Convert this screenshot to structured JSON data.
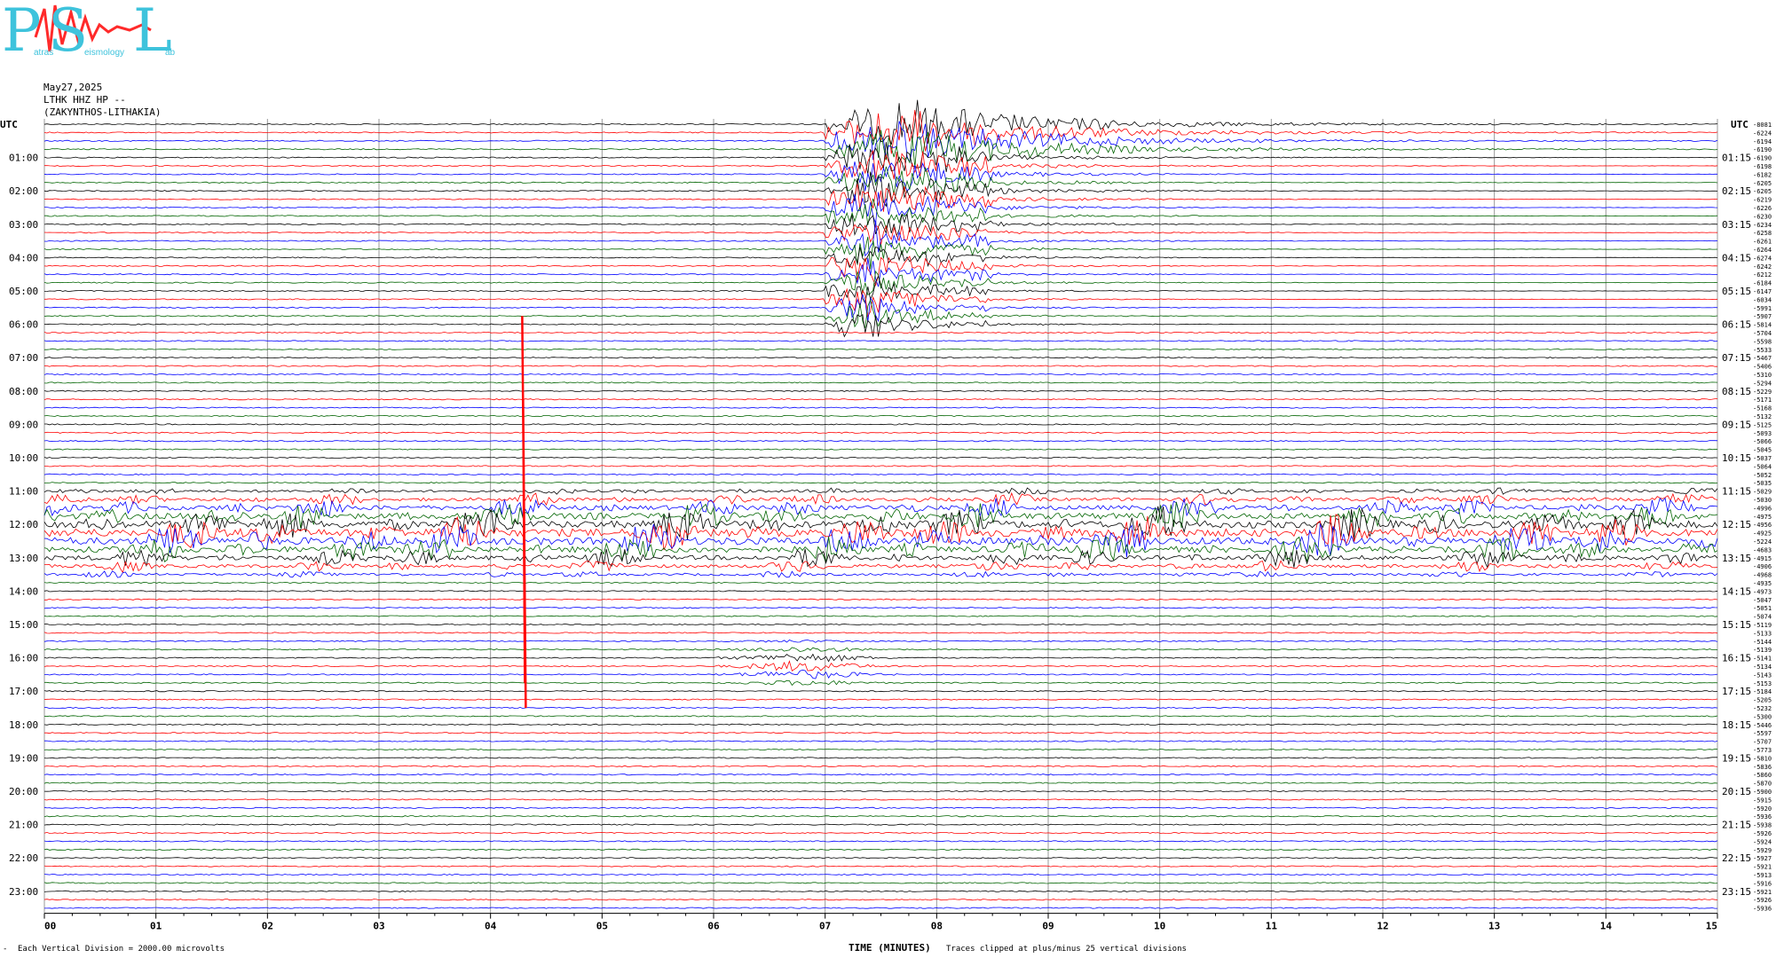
{
  "logo": {
    "letters": [
      "P",
      "S",
      "L"
    ],
    "small_texts": [
      "atras",
      "eismology",
      "ab"
    ],
    "color": "#3ec3dc"
  },
  "header": {
    "date": "May27,2025",
    "station": "LTHK HHZ HP --",
    "location": "(ZAKYNTHOS-LITHAKIA)"
  },
  "left_axis_title": "UTC",
  "right_axis_title": "UTC",
  "footer": {
    "marker": "-",
    "vertical_division": "Each Vertical Division = 2000.00 microvolts",
    "x_axis_title": "TIME (MINUTES)",
    "clip_note": "Traces clipped at plus/minus 25 vertical divisions"
  },
  "chart_data": {
    "type": "line",
    "title": "",
    "xlabel": "TIME (MINUTES)",
    "xlim": [
      0,
      15
    ],
    "x_ticks": [
      "00",
      "01",
      "02",
      "03",
      "04",
      "05",
      "06",
      "07",
      "08",
      "09",
      "10",
      "11",
      "12",
      "13",
      "14",
      "15"
    ],
    "left_hour_labels": [
      "01:00",
      "02:00",
      "03:00",
      "04:00",
      "05:00",
      "06:00",
      "07:00",
      "08:00",
      "09:00",
      "10:00",
      "11:00",
      "12:00",
      "13:00",
      "14:00",
      "15:00",
      "16:00",
      "17:00",
      "18:00",
      "19:00",
      "20:00",
      "21:00",
      "22:00",
      "23:00"
    ],
    "right_hour_labels": [
      "01:15",
      "02:15",
      "03:15",
      "04:15",
      "05:15",
      "06:15",
      "07:15",
      "08:15",
      "09:15",
      "10:15",
      "11:15",
      "12:15",
      "13:15",
      "14:15",
      "15:15",
      "16:15",
      "17:15",
      "18:15",
      "19:15",
      "20:15",
      "21:15",
      "22:15",
      "23:15"
    ],
    "trace_colors": [
      "#000000",
      "#ff0000",
      "#0000ff",
      "#006400"
    ],
    "traces_per_hour": 4,
    "trace_minutes": 15,
    "trace_offsets": [
      "-8081",
      "-6224",
      "-6194",
      "-6190",
      "-6190",
      "-6198",
      "-6182",
      "-6205",
      "-6205",
      "-6219",
      "-6226",
      "-6230",
      "-6234",
      "-6258",
      "-6261",
      "-6264",
      "-6274",
      "-6242",
      "-6212",
      "-6184",
      "-6147",
      "-6034",
      "-5991",
      "-5907",
      "-5814",
      "-5704",
      "-5598",
      "-5533",
      "-5467",
      "-5406",
      "-5310",
      "-5294",
      "-5229",
      "-5171",
      "-5168",
      "-5132",
      "-5125",
      "-5093",
      "-5066",
      "-5045",
      "-5037",
      "-5064",
      "-5052",
      "-5035",
      "-5029",
      "-5030",
      "-4996",
      "-4975",
      "-4956",
      "-4925",
      "-5224",
      "-4683",
      "-4915",
      "-4906",
      "-4968",
      "-4935",
      "-4973",
      "-5047",
      "-5051",
      "-5074",
      "-5119",
      "-5133",
      "-5144",
      "-5139",
      "-5141",
      "-5134",
      "-5143",
      "-5153",
      "-5184",
      "-5205",
      "-5232",
      "-5300",
      "-5446",
      "-5597",
      "-5707",
      "-5773",
      "-5810",
      "-5836",
      "-5860",
      "-5870",
      "-5900",
      "-5915",
      "-5920",
      "-5936",
      "-5938",
      "-5926",
      "-5924",
      "-5929",
      "-5927",
      "-5921",
      "-5913",
      "-5916",
      "-5921",
      "-5926",
      "-5936"
    ],
    "events": [
      {
        "label": "large earthquake",
        "trace_start": 0,
        "trace_end": 24,
        "start_minute": 7.0,
        "peak_minute": 7.5,
        "end_minute": 14.9,
        "color": "#000000"
      },
      {
        "label": "noise burst",
        "trace_start": 44,
        "trace_end": 54,
        "start_minute": 0.1,
        "end_minute": 15.0,
        "color": "mixed"
      },
      {
        "label": "red spike",
        "trace_start": 23,
        "trace_end": 70,
        "minute": 4.3,
        "color": "#ff0000"
      },
      {
        "label": "green burst",
        "trace_start": 62,
        "trace_end": 67,
        "start_minute": 6.0,
        "end_minute": 7.7,
        "color": "#006400"
      }
    ],
    "vertical_division_microvolts": 2000.0,
    "clip_divisions": 25,
    "grid": true
  }
}
